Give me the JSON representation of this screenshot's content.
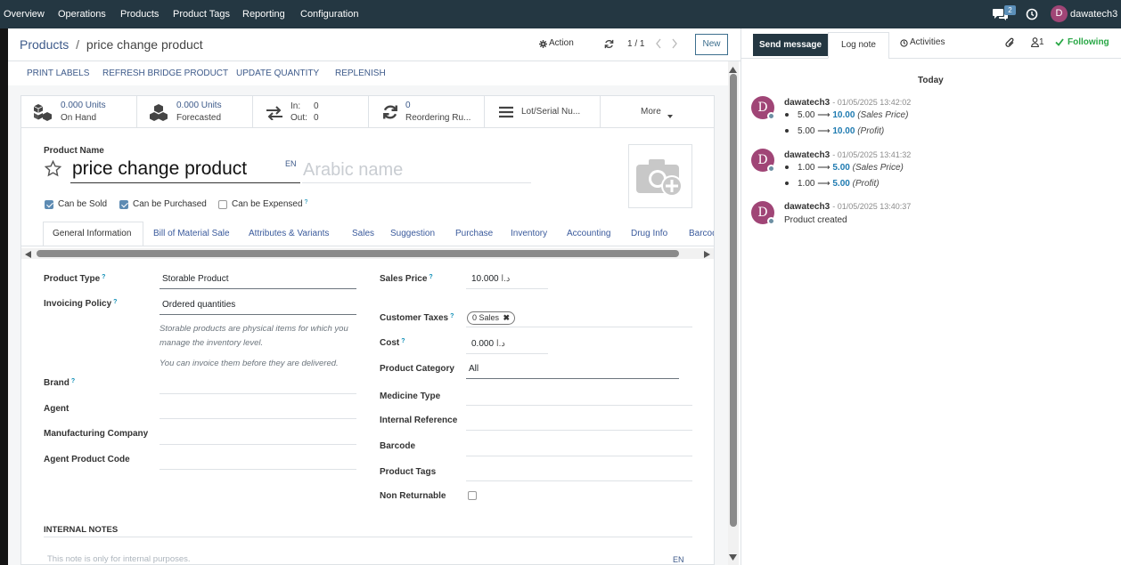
{
  "topbar": {
    "menu": [
      "Overview",
      "Operations",
      "Products",
      "Product Tags",
      "Reporting",
      "Configuration"
    ],
    "message_count": "2",
    "user_initial": "D",
    "user_name": "dawatech3"
  },
  "control": {
    "breadcrumb_parent": "Products",
    "breadcrumb_sep": "/",
    "breadcrumb_current": "price change product",
    "action_label": "Action",
    "pager": "1 / 1",
    "new_label": "New"
  },
  "header_buttons": [
    "PRINT LABELS",
    "REFRESH BRIDGE PRODUCT",
    "UPDATE QUANTITY",
    "REPLENISH"
  ],
  "smart_buttons": {
    "on_hand_value": "0.000 Units",
    "on_hand_label": "On Hand",
    "forecasted_value": "0.000 Units",
    "forecasted_label": "Forecasted",
    "in_label": "In:",
    "in_value": "0",
    "out_label": "Out:",
    "out_value": "0",
    "reordering_value": "0",
    "reordering_label": "Reordering Ru...",
    "lot_label": "Lot/Serial Nu...",
    "more_label": "More"
  },
  "product": {
    "name_label": "Product Name",
    "name": "price change product",
    "lang": "EN",
    "arabic_placeholder": "Arabic name",
    "can_be_sold": "Can be Sold",
    "can_be_purchased": "Can be Purchased",
    "can_be_expensed": "Can be Expensed"
  },
  "tabs": [
    "General Information",
    "Bill of Material Sale",
    "Attributes & Variants",
    "Sales",
    "Suggestion",
    "Purchase",
    "Inventory",
    "Accounting",
    "Drug Info",
    "Barcode"
  ],
  "left_fields": {
    "product_type_label": "Product Type",
    "product_type": "Storable Product",
    "invoicing_policy_label": "Invoicing Policy",
    "invoicing_policy": "Ordered quantities",
    "help_1": "Storable products are physical items for which you manage the inventory level.",
    "help_2": "You can invoice them before they are delivered.",
    "brand_label": "Brand",
    "agent_label": "Agent",
    "manufacturing_label": "Manufacturing Company",
    "agent_code_label": "Agent Product Code"
  },
  "right_fields": {
    "sales_price_label": "Sales Price",
    "currency": "د.ا",
    "sales_price": "10.000",
    "customer_taxes_label": "Customer Taxes",
    "tax_tag": "0 Sales",
    "cost_label": "Cost",
    "cost": "0.000",
    "category_label": "Product Category",
    "category": "All",
    "medicine_type_label": "Medicine Type",
    "internal_ref_label": "Internal Reference",
    "barcode_label": "Barcode",
    "product_tags_label": "Product Tags",
    "non_returnable_label": "Non Returnable"
  },
  "notes": {
    "title": "INTERNAL NOTES",
    "placeholder": "This note is only for internal purposes.",
    "lang": "EN"
  },
  "chatter": {
    "send_message": "Send message",
    "log_note": "Log note",
    "activities": "Activities",
    "followers_count": "1",
    "following": "Following",
    "today": "Today",
    "messages": [
      {
        "author": "dawatech3",
        "date": "- 01/05/2025 13:42:02",
        "lines": [
          {
            "old": "5.00",
            "new": "10.00",
            "field": "(Sales Price)"
          },
          {
            "old": "5.00",
            "new": "10.00",
            "field": "(Profit)"
          }
        ]
      },
      {
        "author": "dawatech3",
        "date": "- 01/05/2025 13:41:32",
        "lines": [
          {
            "old": "1.00",
            "new": "5.00",
            "field": "(Sales Price)"
          },
          {
            "old": "1.00",
            "new": "5.00",
            "field": "(Profit)"
          }
        ]
      },
      {
        "author": "dawatech3",
        "date": "- 01/05/2025 13:40:37",
        "text": "Product created"
      }
    ],
    "arrow": "⟶"
  }
}
